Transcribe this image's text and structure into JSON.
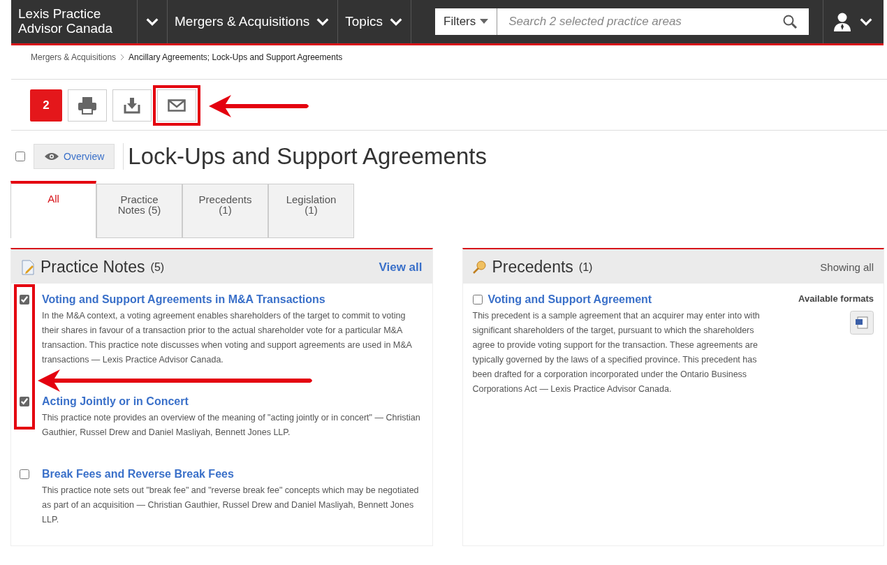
{
  "header": {
    "brand": [
      "Lexis Practice",
      "Advisor Canada"
    ],
    "nav": [
      {
        "label": "Mergers & Acquisitions"
      },
      {
        "label": "Topics"
      }
    ],
    "filters": "Filters",
    "search": {
      "placeholder": "Search 2 selected practice areas"
    }
  },
  "breadcrumb": [
    "Mergers & Acquisitions",
    "Ancillary Agreements; Lock-Ups and Support Agreements"
  ],
  "toolbar": {
    "count": "2",
    "buttons": [
      {
        "kind": "print",
        "highlighted": false
      },
      {
        "kind": "download",
        "highlighted": false
      },
      {
        "kind": "email",
        "highlighted": true
      }
    ]
  },
  "page": {
    "checked": false,
    "overview": "Overview",
    "title": "Lock-Ups and Support Agreements"
  },
  "tabs": [
    {
      "label": "All",
      "selected": true
    },
    {
      "label": "Practice Notes (5)",
      "selected": false
    },
    {
      "label": "Precedents (1)",
      "selected": false
    },
    {
      "label": "Legislation (1)",
      "selected": false
    }
  ],
  "practice_notes": {
    "title": "Practice Notes",
    "count": "(5)",
    "link": "View all",
    "checkbox_highlight": true,
    "items": [
      {
        "title": "Voting and Support Agreements in M&A Transactions",
        "checked": true,
        "text": "In the M&A context, a voting agreement enables shareholders of the target to commit to voting their shares in favour of a transaction prior to the actual shareholder vote for a particular M&A transaction. This practice note discusses when voting and support agreements are used in M&A transactions — Lexis Practice Advisor Canada."
      },
      {
        "title": "Acting Jointly or in Concert",
        "checked": true,
        "text": "This practice note provides an overview of the meaning of \"acting jointly or in concert\" — Christian Gauthier, Russel Drew and Daniel Masliyah, Bennett Jones LLP."
      },
      {
        "title": "Break Fees and Reverse Break Fees",
        "checked": false,
        "text": "This practice note sets out \"break fee\" and \"reverse break fee\" concepts which may be negotiated as part of an acquisition — Christian Gauthier, Russel Drew and Daniel Masliyah, Bennett Jones LLP."
      }
    ]
  },
  "precedents": {
    "title": "Precedents",
    "count": "(1)",
    "note": "Showing all",
    "items": [
      {
        "title": "Voting and Support Agreement",
        "checked": false,
        "formats_label": "Available formats",
        "text": "This precedent is a sample agreement that an acquirer may enter into with significant shareholders of the target, pursuant to which the shareholders agree to provide voting support for the transaction. These agreements are typically governed by the laws of a specified province. This precedent has been drafted for a corporation incorporated under the Ontario Business Corporations Act — Lexis Practice Advisor Canada."
      }
    ]
  }
}
